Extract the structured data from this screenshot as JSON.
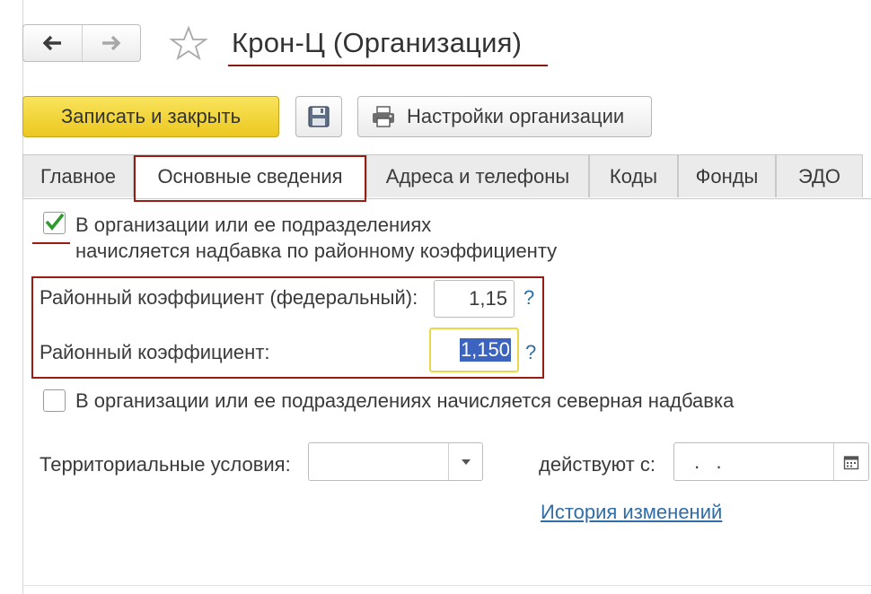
{
  "window": {
    "title": "Крон-Ц (Организация)"
  },
  "toolbar": {
    "save_close_label": "Записать и закрыть",
    "settings_label": "Настройки организации",
    "icons": {
      "back": "arrow-left-icon",
      "forward": "arrow-right-icon",
      "favorite": "star-icon",
      "save": "floppy-disk-icon",
      "settings": "printer-icon"
    }
  },
  "tabs": [
    {
      "label": "Главное",
      "active": false
    },
    {
      "label": "Основные сведения",
      "active": true
    },
    {
      "label": "Адреса и телефоны",
      "active": false
    },
    {
      "label": "Коды",
      "active": false
    },
    {
      "label": "Фонды",
      "active": false
    },
    {
      "label": "ЭДО",
      "active": false
    }
  ],
  "form": {
    "regional_allowance": {
      "checked": true,
      "label_line1": "В организации или ее подразделениях",
      "label_line2": "начисляется надбавка по районному коэффициенту"
    },
    "federal_coef": {
      "label": "Районный коэффициент (федеральный):",
      "value": "1,15",
      "help": "?"
    },
    "coef": {
      "label": "Районный коэффициент:",
      "value": "1,150",
      "help": "?"
    },
    "northern_allowance": {
      "checked": false,
      "label": "В организации или ее подразделениях начисляется северная надбавка"
    },
    "territorial": {
      "label": "Территориальные условия:",
      "value": ""
    },
    "effective": {
      "label": "действуют с:",
      "value": " .  ."
    },
    "history_link": "История изменений"
  },
  "colors": {
    "accent_yellow": "#f3d93f",
    "highlight_red": "#9a1c12",
    "link_blue": "#2f6ca8",
    "selection_blue": "#3b63bf",
    "check_green": "#2e9a2e"
  }
}
